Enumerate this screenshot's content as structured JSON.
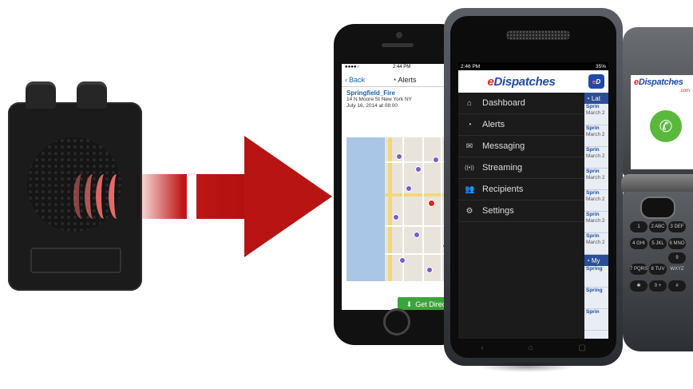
{
  "colors": {
    "arrow": "#b81414",
    "brand_blue": "#1f4aa8",
    "brand_red": "#dd2222",
    "button_green": "#3aa53a"
  },
  "iphone": {
    "status_carrier": "●●●●○",
    "status_time": "2:44 PM",
    "status_batt": "▮▮▮",
    "back_label": "Back",
    "nav_title": "Alerts",
    "incident_name": "Springfield_Fire",
    "incident_address": "14 N Moore St New York NY",
    "incident_date": "July 16, 2014 at 08:00",
    "directions_button": "Get Directions"
  },
  "android": {
    "status_time": "2:46 PM",
    "status_batt": "35%",
    "logo_e": "e",
    "logo_rest": "Dispatches",
    "badge_e": "e",
    "badge_d": "D",
    "menu": [
      {
        "icon": "home-icon",
        "glyph": "⌂",
        "label": "Dashboard"
      },
      {
        "icon": "bell-icon",
        "glyph": "◔",
        "label": "Alerts"
      },
      {
        "icon": "envelope-icon",
        "glyph": "✉",
        "label": "Messaging"
      },
      {
        "icon": "broadcast-icon",
        "glyph": "((•))",
        "label": "Streaming"
      },
      {
        "icon": "people-icon",
        "glyph": "👥",
        "label": "Recipients"
      },
      {
        "icon": "gear-icon",
        "glyph": "⚙",
        "label": "Settings"
      }
    ],
    "side_section_1": "Lat",
    "side_section_2": "My",
    "side_entries_1": [
      {
        "t": "Sprin",
        "d": "March 2"
      },
      {
        "t": "Sprin",
        "d": "March 2"
      },
      {
        "t": "Sprin",
        "d": "March 2"
      },
      {
        "t": "Sprin",
        "d": "March 2"
      },
      {
        "t": "Sprin",
        "d": "March 2"
      },
      {
        "t": "Sprin",
        "d": "March 2"
      },
      {
        "t": "Sprin",
        "d": "March 2"
      }
    ],
    "side_entries_2": [
      {
        "t": "Spring"
      },
      {
        "t": "Spring"
      },
      {
        "t": "Sprin"
      }
    ],
    "nav": [
      "‹",
      "⌂",
      "▢"
    ]
  },
  "flip": {
    "logo_e": "e",
    "logo_rest": "Dispatches",
    "logo_sub": ".com",
    "keys": [
      "1",
      "2 ABC",
      "3 DEF",
      "4 GHI",
      "5 JKL",
      "6 MNO",
      "7 PQRS",
      "8 TUV",
      "9 WXYZ",
      "✱",
      "0 +",
      "#"
    ]
  }
}
